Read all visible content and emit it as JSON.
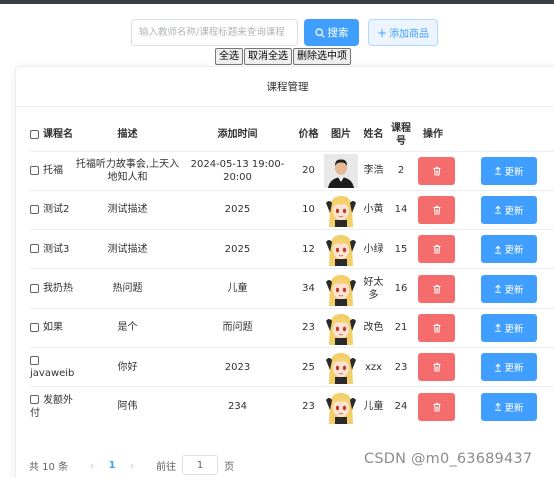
{
  "toolbar": {
    "search_placeholder": "输入教师名称/课程标题来查询课程",
    "search_label": "搜索",
    "add_label": "添加商品"
  },
  "native_buttons": {
    "select_all": "全选",
    "cancel_all": "取消全选",
    "delete_selected": "删除选中项"
  },
  "card": {
    "title": "课程管理"
  },
  "table": {
    "headers": {
      "name": "课程名",
      "desc": "描述",
      "time": "添加时间",
      "price": "价格",
      "pic": "图片",
      "teacher": "姓名",
      "num": "课程号",
      "ops": "操作"
    },
    "rows": [
      {
        "name": "托福",
        "desc": "托福听力故事会,上天入地知人和",
        "time": "2024-05-13 19:00-20:00",
        "price": "20",
        "teacher": "李浩",
        "num": "2",
        "avatar": "man-photo"
      },
      {
        "name": "测试2",
        "desc": "测试描述",
        "time": "2025",
        "price": "10",
        "teacher": "小黄",
        "num": "14",
        "avatar": "anime-girl"
      },
      {
        "name": "测试3",
        "desc": "测试描述",
        "time": "2025",
        "price": "12",
        "teacher": "小绿",
        "num": "15",
        "avatar": "anime-girl"
      },
      {
        "name": "我扔热",
        "desc": "热问题",
        "time": "儿童",
        "price": "34",
        "teacher": "好太多",
        "num": "16",
        "avatar": "anime-girl"
      },
      {
        "name": "如果",
        "desc": "是个",
        "time": "而问题",
        "price": "23",
        "teacher": "改色",
        "num": "21",
        "avatar": "anime-girl"
      },
      {
        "name": "javaweib",
        "desc": "你好",
        "time": "2023",
        "price": "25",
        "teacher": "xzx",
        "num": "23",
        "avatar": "anime-girl"
      },
      {
        "name": "发额外付",
        "desc": "阿伟",
        "time": "234",
        "price": "23",
        "teacher": "儿童",
        "num": "24",
        "avatar": "anime-girl"
      }
    ],
    "update_label": "更新"
  },
  "pagination": {
    "total": "共 10 条",
    "prev": "‹",
    "current_page": "1",
    "next": "›",
    "goto": "前往",
    "page_input": "1",
    "suffix": "页"
  },
  "watermark": "CSDN @m0_63689437",
  "colors": {
    "primary": "#409eff",
    "danger": "#f56c6c",
    "border": "#ebeef5"
  }
}
